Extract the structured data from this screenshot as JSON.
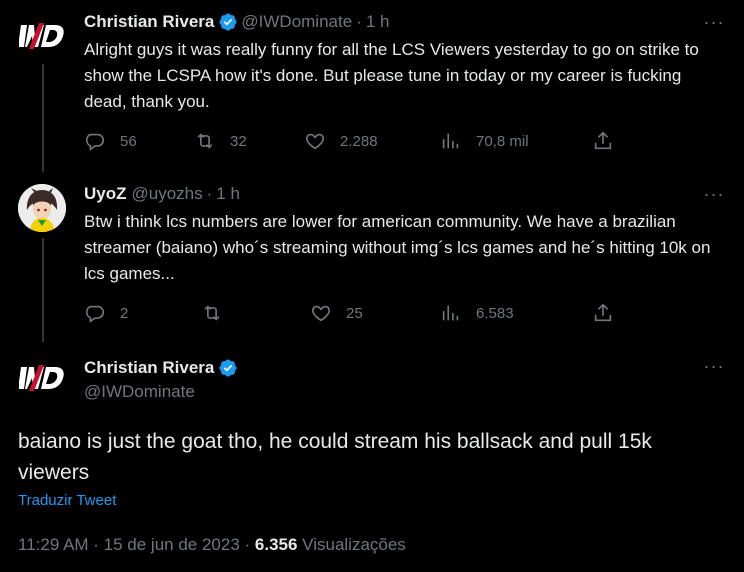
{
  "tweets": [
    {
      "name": "Christian Rivera",
      "handle": "@IWDominate",
      "sep": "·",
      "time": "1 h",
      "text": "Alright guys it was really funny for all the LCS Viewers yesterday to go on strike to show the LCSPA how it's done.  But please tune in today or my career is fucking dead, thank you.",
      "replies": "56",
      "retweets": "32",
      "likes": "2.288",
      "views": "70,8 mil"
    },
    {
      "name": "UyoZ",
      "handle": "@uyozhs",
      "sep": "·",
      "time": "1 h",
      "text": "Btw i think lcs numbers are lower for american community. We have a brazilian streamer (baiano) who´s streaming without img´s lcs games and he´s hitting 10k on lcs games...",
      "replies": "2",
      "retweets": "",
      "likes": "25",
      "views": "6.583"
    }
  ],
  "main": {
    "name": "Christian Rivera",
    "handle": "@IWDominate",
    "text": "baiano is just the goat tho, he could stream his ballsack and pull 15k viewers",
    "translate": "Traduzir Tweet",
    "timestamp": "11:29 AM · 15 de jun de 2023 · ",
    "views_count": "6.356",
    "views_label": " Visualizações"
  },
  "more_label": "···",
  "colors": {
    "background": "#000000",
    "accent": "#1d9bf0",
    "muted": "#71767b",
    "text": "#e7e9ea"
  }
}
